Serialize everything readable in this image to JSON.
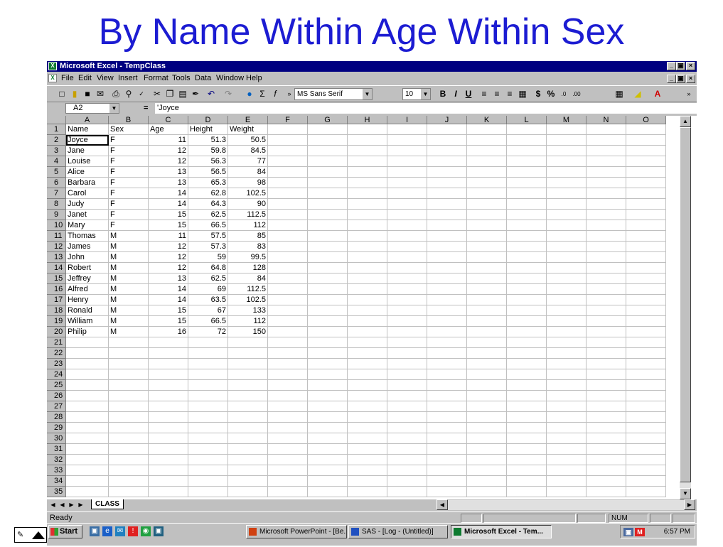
{
  "slide": {
    "title": "By Name Within Age Within Sex"
  },
  "window": {
    "title": "Microsoft Excel - TempClass",
    "app_icon": "excel-icon",
    "doc_icon": "workbook-icon",
    "controls": [
      "_",
      "▣",
      "×"
    ],
    "doc_controls": [
      "_",
      "▣",
      "×"
    ]
  },
  "menu": [
    "File",
    "Edit",
    "View",
    "Insert",
    "Format",
    "Tools",
    "Data",
    "Window",
    "Help"
  ],
  "toolbar": {
    "font_name": "MS Sans Serif",
    "font_size": "10",
    "icons": [
      "new-icon",
      "open-icon",
      "save-icon",
      "email-icon",
      "print-icon",
      "print-preview-icon",
      "spelling-icon",
      "cut-icon",
      "copy-icon",
      "paste-icon",
      "format-painter-icon",
      "undo-icon",
      "redo-icon",
      "hyperlink-icon",
      "autosum-icon",
      "function-icon",
      "more-buttons-icon",
      "bold-icon",
      "italic-icon",
      "underline-icon",
      "align-left-icon",
      "center-icon",
      "align-right-icon",
      "merge-center-icon",
      "currency-icon",
      "percent-icon",
      "increase-decimal-icon",
      "decrease-decimal-icon",
      "borders-icon",
      "fill-color-icon",
      "font-color-icon",
      "more-buttons-icon"
    ]
  },
  "formula_bar": {
    "name_box": "A2",
    "equals": "=",
    "formula": "'Joyce"
  },
  "columns": [
    "A",
    "B",
    "C",
    "D",
    "E",
    "F",
    "G",
    "H",
    "I",
    "J",
    "K",
    "L",
    "M",
    "N",
    "O"
  ],
  "rows": [
    [
      "Name",
      "Sex",
      "Age",
      "Height",
      "Weight"
    ],
    [
      "Joyce",
      "F",
      "11",
      "51.3",
      "50.5"
    ],
    [
      "Jane",
      "F",
      "12",
      "59.8",
      "84.5"
    ],
    [
      "Louise",
      "F",
      "12",
      "56.3",
      "77"
    ],
    [
      "Alice",
      "F",
      "13",
      "56.5",
      "84"
    ],
    [
      "Barbara",
      "F",
      "13",
      "65.3",
      "98"
    ],
    [
      "Carol",
      "F",
      "14",
      "62.8",
      "102.5"
    ],
    [
      "Judy",
      "F",
      "14",
      "64.3",
      "90"
    ],
    [
      "Janet",
      "F",
      "15",
      "62.5",
      "112.5"
    ],
    [
      "Mary",
      "F",
      "15",
      "66.5",
      "112"
    ],
    [
      "Thomas",
      "M",
      "11",
      "57.5",
      "85"
    ],
    [
      "James",
      "M",
      "12",
      "57.3",
      "83"
    ],
    [
      "John",
      "M",
      "12",
      "59",
      "99.5"
    ],
    [
      "Robert",
      "M",
      "12",
      "64.8",
      "128"
    ],
    [
      "Jeffrey",
      "M",
      "13",
      "62.5",
      "84"
    ],
    [
      "Alfred",
      "M",
      "14",
      "69",
      "112.5"
    ],
    [
      "Henry",
      "M",
      "14",
      "63.5",
      "102.5"
    ],
    [
      "Ronald",
      "M",
      "15",
      "67",
      "133"
    ],
    [
      "William",
      "M",
      "15",
      "66.5",
      "112"
    ],
    [
      "Philip",
      "M",
      "16",
      "72",
      "150"
    ]
  ],
  "row_count": 35,
  "sheet_tab": "CLASS",
  "status": {
    "ready": "Ready",
    "num": "NUM"
  },
  "taskbar": {
    "start": "Start",
    "tasks": [
      {
        "label": "Microsoft PowerPoint - [Be...",
        "active": false
      },
      {
        "label": "SAS - [Log - (Untitled)]",
        "active": false
      },
      {
        "label": "Microsoft Excel - Tem...",
        "active": true
      }
    ],
    "clock": "6:57 PM",
    "tray_icons": [
      "network-icon",
      "m-icon"
    ]
  },
  "colors": {
    "title": "#1c1cd2",
    "titlebar": "#000080",
    "chrome": "#c0c0c0"
  }
}
